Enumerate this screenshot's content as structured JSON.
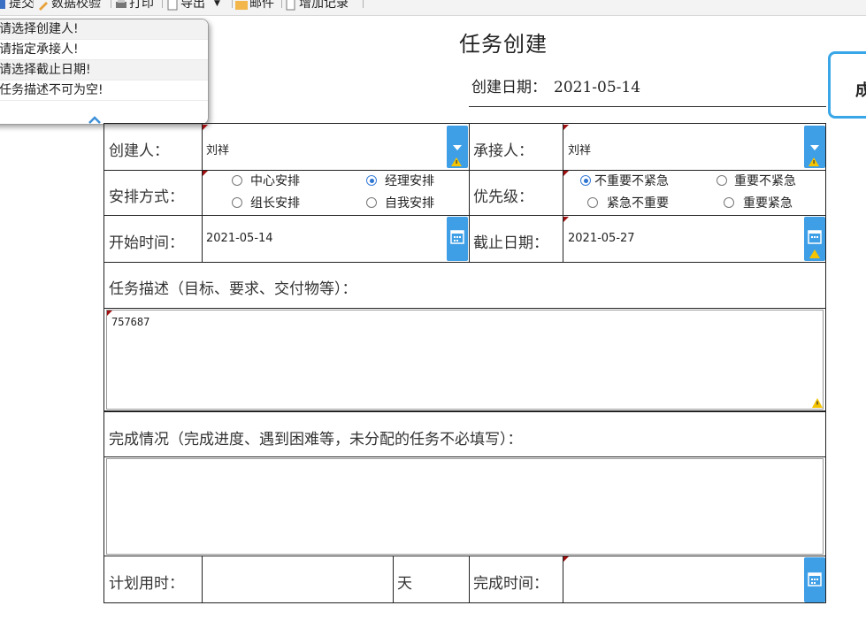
{
  "toolbar": {
    "items": [
      {
        "label": "提交",
        "icon": "submit-icon"
      },
      {
        "label": "数据校验",
        "icon": "pencil-icon"
      },
      {
        "label": "打印",
        "icon": "printer-icon"
      },
      {
        "label": "导出",
        "icon": "export-icon"
      },
      {
        "label": "邮件",
        "icon": "mail-icon"
      },
      {
        "label": "增加记录",
        "icon": "add-record-icon"
      }
    ]
  },
  "validation_popup": {
    "messages": [
      "请选择创建人!",
      "请指定承接人!",
      "请选择截止日期!",
      "任务描述不可为空!"
    ]
  },
  "side_card": {
    "text": "成"
  },
  "form": {
    "title": "任务创建",
    "created_date_label": "创建日期：",
    "created_date": "2021-05-14",
    "creator_label": "创建人：",
    "creator_value": "刘祥",
    "assignee_label": "承接人：",
    "assignee_value": "刘祥",
    "arrangement_label": "安排方式：",
    "arrangement_options": [
      "中心安排",
      "经理安排",
      "组长安排",
      "自我安排"
    ],
    "arrangement_selected": "经理安排",
    "priority_label": "优先级：",
    "priority_options": [
      "不重要不紧急",
      "重要不紧急",
      "紧急不重要",
      "重要紧急"
    ],
    "priority_selected": "不重要不紧急",
    "start_label": "开始时间：",
    "start_value": "2021-05-14",
    "deadline_label": "截止日期：",
    "deadline_value": "2021-05-27",
    "description_label": "任务描述（目标、要求、交付物等）：",
    "description_value": "757687",
    "completion_label": "完成情况（完成进度、遇到困难等，未分配的任务不必填写）：",
    "completion_value": "",
    "planned_label": "计划用时：",
    "planned_value": "",
    "planned_unit": "天",
    "finish_label": "完成时间：",
    "finish_value": ""
  },
  "colors": {
    "accent": "#3f9fe6",
    "required_marker": "#a01010",
    "warning": "#f5c400",
    "side_card_border": "#39a6e8"
  }
}
